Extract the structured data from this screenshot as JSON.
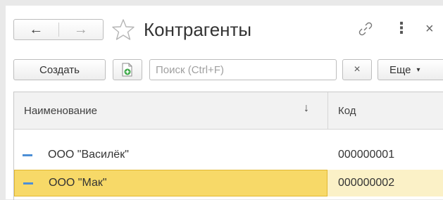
{
  "header": {
    "title": "Контрагенты",
    "back_glyph": "←",
    "forward_glyph": "→",
    "more_glyph": "⋮",
    "close_glyph": "×"
  },
  "toolbar": {
    "create_label": "Создать",
    "search_placeholder": "Поиск (Ctrl+F)",
    "search_value": "",
    "clear_glyph": "×",
    "more_label": "Еще",
    "more_caret": "▾"
  },
  "table": {
    "columns": [
      {
        "label": "Наименование",
        "sort": "↓"
      },
      {
        "label": "Код"
      }
    ],
    "rows": [
      {
        "name": "ООО \"Василёк\"",
        "code": "000000001",
        "selected": false
      },
      {
        "name": "ООО \"Мак\"",
        "code": "000000002",
        "selected": true
      }
    ]
  },
  "colors": {
    "selection": "#f7d968",
    "selection_border": "#e2b832",
    "item_marker": "#4d8fd6",
    "add_icon": "#3fa84a"
  }
}
